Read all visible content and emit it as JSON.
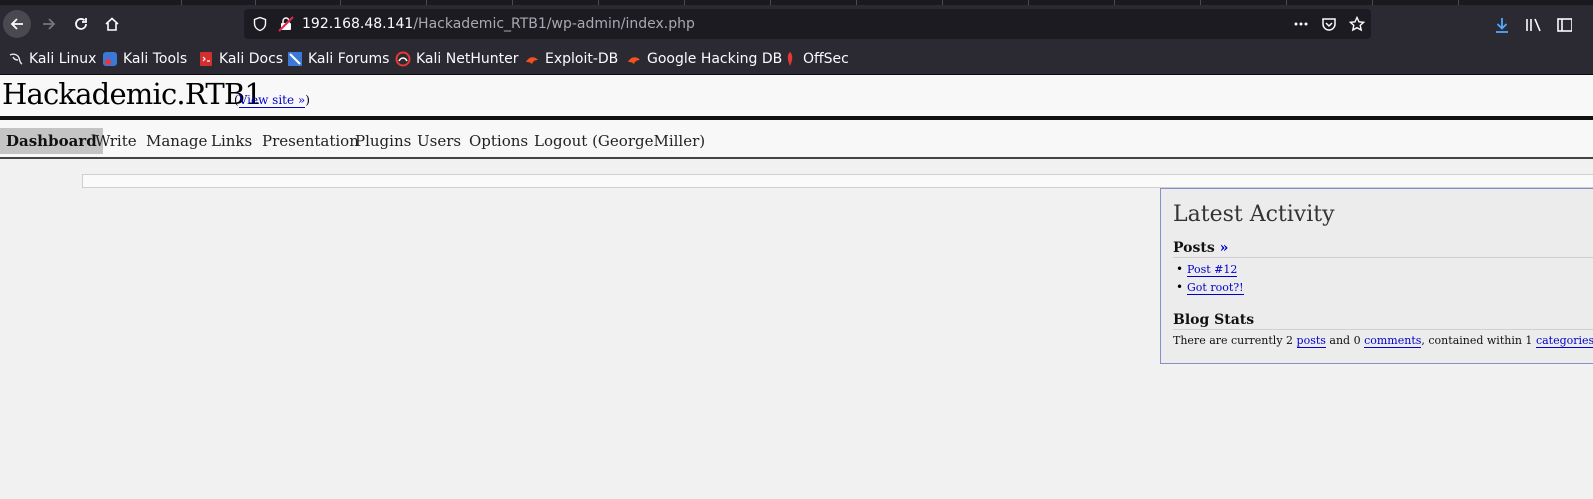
{
  "browser": {
    "url_host": "192.168.48.141",
    "url_path": "/Hackademic_RTB1/wp-admin/index.php"
  },
  "bookmarks": [
    {
      "label": "Kali Linux",
      "icon": "kali-dragon-icon"
    },
    {
      "label": "Kali Tools",
      "icon": "kali-tools-icon"
    },
    {
      "label": "Kali Docs",
      "icon": "kali-docs-icon"
    },
    {
      "label": "Kali Forums",
      "icon": "kali-forums-icon"
    },
    {
      "label": "Kali NetHunter",
      "icon": "nethunter-icon"
    },
    {
      "label": "Exploit-DB",
      "icon": "exploit-db-icon"
    },
    {
      "label": "Google Hacking DB",
      "icon": "ghdb-icon"
    },
    {
      "label": "OffSec",
      "icon": "offsec-icon"
    }
  ],
  "site": {
    "title": "Hackademic.RTB1",
    "view_site": "View site »",
    "paren_open": "(",
    "paren_close": ")"
  },
  "menu": [
    {
      "label": "Dashboard",
      "current": true
    },
    {
      "label": "Write"
    },
    {
      "label": "Manage"
    },
    {
      "label": "Links"
    },
    {
      "label": "Presentation"
    },
    {
      "label": "Plugins"
    },
    {
      "label": "Users"
    },
    {
      "label": "Options"
    },
    {
      "label": "Logout (GeorgeMiller)"
    }
  ],
  "activity": {
    "title": "Latest Activity",
    "posts_heading": "Posts",
    "posts_more": "»",
    "posts": [
      "Post #12",
      "Got root?!"
    ],
    "stats_heading": "Blog Stats",
    "stats": {
      "t1": "There are currently 2 ",
      "posts_link": "posts",
      "t2": " and 0 ",
      "comments_link": "comments",
      "t3": ", contained within 1 ",
      "categories_link": "categories",
      "t4": "."
    }
  },
  "colors": {
    "link": "#0000cc",
    "browser_chrome": "#2b2a33",
    "download_accent": "#54a8ff"
  }
}
